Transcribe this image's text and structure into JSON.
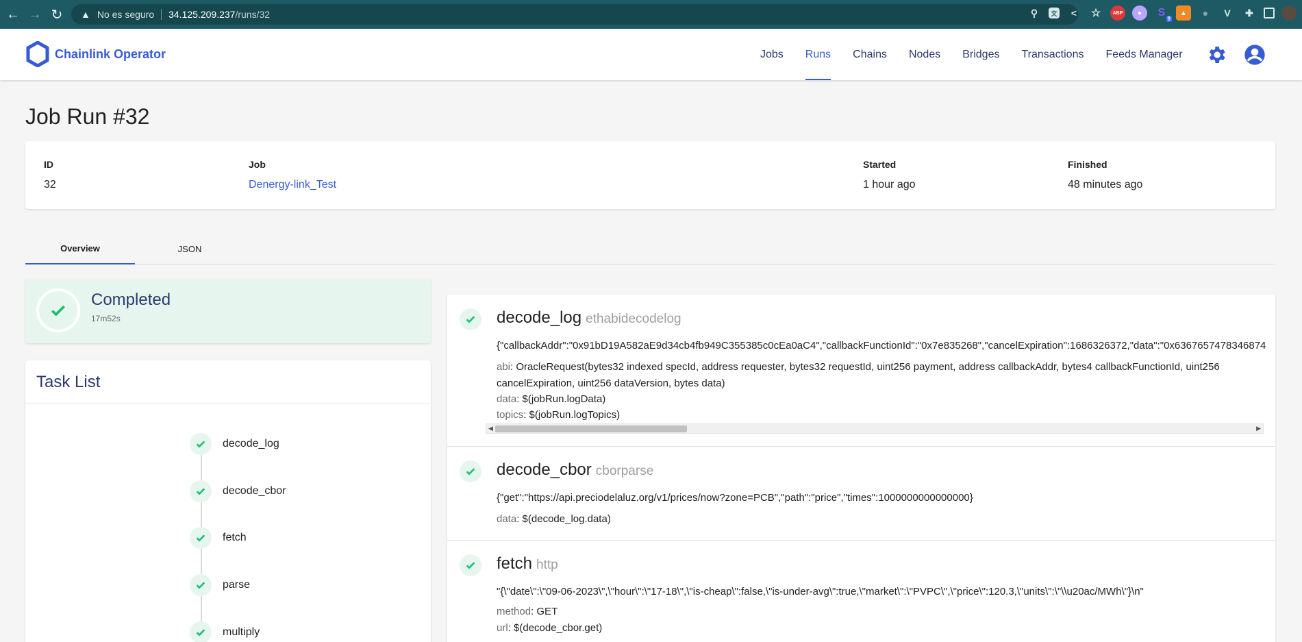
{
  "browser": {
    "insecure_label": "No es seguro",
    "url_host": "34.125.209.237",
    "url_path": "/runs/32",
    "extensions": [
      "key-icon",
      "translate-icon",
      "share-icon",
      "star-icon",
      "adblock-icon",
      "ghost-icon",
      "s-extension-icon",
      "metamask-icon",
      "bug-icon",
      "v-extension-icon",
      "puzzle-icon",
      "sidebar-icon",
      "profile-avatar"
    ],
    "s_badge": "9"
  },
  "app": {
    "brand": "Chainlink Operator",
    "nav": [
      "Jobs",
      "Runs",
      "Chains",
      "Nodes",
      "Bridges",
      "Transactions",
      "Feeds Manager"
    ],
    "active_nav": "Runs",
    "accent": "#375bd2",
    "success": "#1dbf73"
  },
  "page": {
    "title": "Job Run #32"
  },
  "details": {
    "id_label": "ID",
    "id_value": "32",
    "job_label": "Job",
    "job_value": "Denergy-link_Test",
    "started_label": "Started",
    "started_value": "1 hour ago",
    "finished_label": "Finished",
    "finished_value": "48 minutes ago"
  },
  "tabs": [
    "Overview",
    "JSON"
  ],
  "status": {
    "title": "Completed",
    "duration": "17m52s"
  },
  "tasklist": {
    "title": "Task List",
    "tasks": [
      "decode_log",
      "decode_cbor",
      "fetch",
      "parse",
      "multiply"
    ]
  },
  "task_details": [
    {
      "name": "decode_log",
      "type": "ethabidecodelog",
      "output": "{\"callbackAddr\":\"0x91bD19A582aE9d34cb4fb949C355385c0cEa0aC4\",\"callbackFunctionId\":\"0x7e835268\",\"cancelExpiration\":1686326372,\"data\":\"0x6367657478346874",
      "params": [
        {
          "key": "abi",
          "value": "OracleRequest(bytes32 indexed specId, address requester, bytes32 requestId, uint256 payment, address callbackAddr, bytes4 callbackFunctionId, uint256"
        },
        {
          "key": "",
          "value": "cancelExpiration, uint256 dataVersion, bytes data)"
        },
        {
          "key": "data",
          "value": "$(jobRun.logData)"
        },
        {
          "key": "topics",
          "value": "$(jobRun.logTopics)"
        }
      ]
    },
    {
      "name": "decode_cbor",
      "type": "cborparse",
      "output": "{\"get\":\"https://api.preciodelaluz.org/v1/prices/now?zone=PCB\",\"path\":\"price\",\"times\":1000000000000000}",
      "params": [
        {
          "key": "data",
          "value": "$(decode_log.data)"
        }
      ]
    },
    {
      "name": "fetch",
      "type": "http",
      "output": "\"{\\\"date\\\":\\\"09-06-2023\\\",\\\"hour\\\":\\\"17-18\\\",\\\"is-cheap\\\":false,\\\"is-under-avg\\\":true,\\\"market\\\":\\\"PVPC\\\",\\\"price\\\":120.3,\\\"units\\\":\\\"\\\\u20ac/MWh\\\"}\\n\"",
      "params": [
        {
          "key": "method",
          "value": "GET"
        },
        {
          "key": "url",
          "value": "$(decode_cbor.get)"
        }
      ]
    }
  ]
}
